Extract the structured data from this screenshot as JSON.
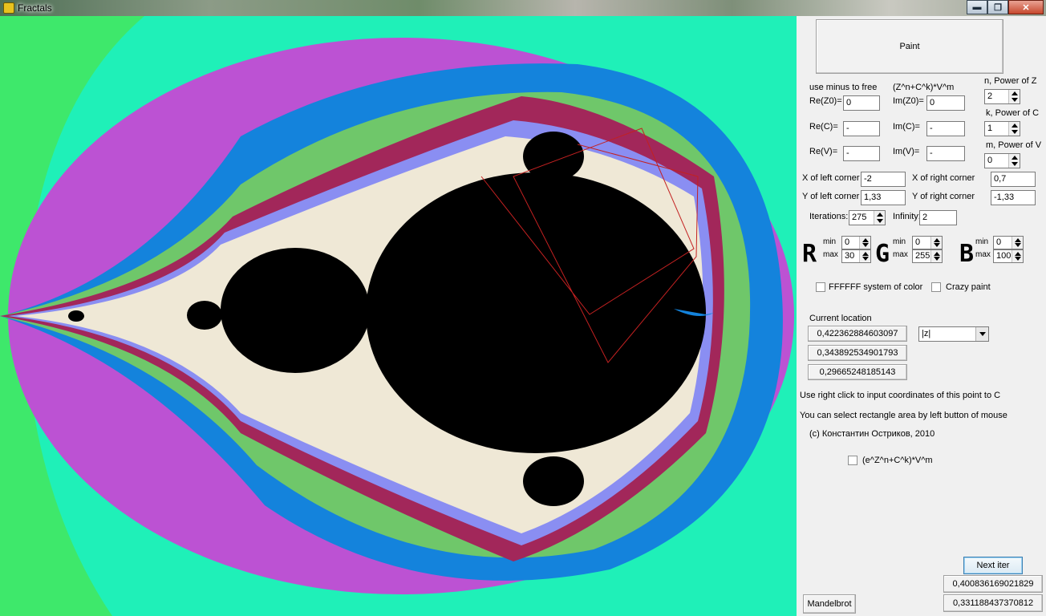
{
  "window": {
    "title": "Fractals",
    "buttons": {
      "minimize": "▬",
      "restore": "❐",
      "close": "✕"
    }
  },
  "colors": {
    "panel_bg": "#f0f0f0",
    "green": "#3ee86b",
    "cyan": "#1ff0b8",
    "magenta": "#bc52d3",
    "blue": "#1483dc",
    "light_green": "#6fc76a",
    "black": "#000000"
  },
  "panel": {
    "paint_label": "Paint",
    "hint_free": "use minus to free",
    "formula": "(Z^n+C^k)*V^m",
    "power_z_label": "n, Power of Z",
    "power_z": "2",
    "power_c_label": "k, Power of C",
    "power_c": "1",
    "power_v_label": "m, Power of V",
    "power_v": "0",
    "re_z0_label": "Re(Z0)=",
    "re_z0": "0",
    "im_z0_label": "Im(Z0)=",
    "im_z0": "0",
    "re_c_label": "Re(C)=",
    "re_c": "-",
    "im_c_label": "Im(C)=",
    "im_c": "-",
    "re_v_label": "Re(V)=",
    "re_v": "-",
    "im_v_label": "Im(V)=",
    "im_v": "-",
    "x_left_label": "X of left corner",
    "x_left": "-2",
    "x_right_label": "X of right corner",
    "x_right": "0,7",
    "y_left_label": "Y of left corner",
    "y_left": "1,33",
    "y_right_label": "Y of right corner",
    "y_right": "-1,33",
    "iterations_label": "Iterations:",
    "iterations": "275",
    "infinity_label": "Infinity:",
    "infinity": "2",
    "r_letter": "R",
    "g_letter": "G",
    "b_letter": "B",
    "min_label": "min",
    "max_label": "max",
    "r_min": "0",
    "r_max": "30",
    "g_min": "0",
    "g_max": "255",
    "b_min": "0",
    "b_max": "100",
    "ffffff_label": "FFFFFF system of color",
    "crazy_label": "Crazy paint",
    "current_location_label": "Current location",
    "loc1": "0,422362884603097",
    "loc2": "0,343892534901793",
    "loc3": "0,29665248185143",
    "select_value": "|z|",
    "hint_right_click": "Use right click to input coordinates of this point to C",
    "hint_select": "You can select rectangle area by left button of mouse",
    "copyright": "(c) Константин Остриков, 2010",
    "exp_label": "(e^Z^n+C^k)*V^m",
    "next_iter": "Next iter",
    "next_val1": "0,400836169021829",
    "next_val2": "0,331188437370812",
    "mandelbrot": "Mandelbrot"
  }
}
